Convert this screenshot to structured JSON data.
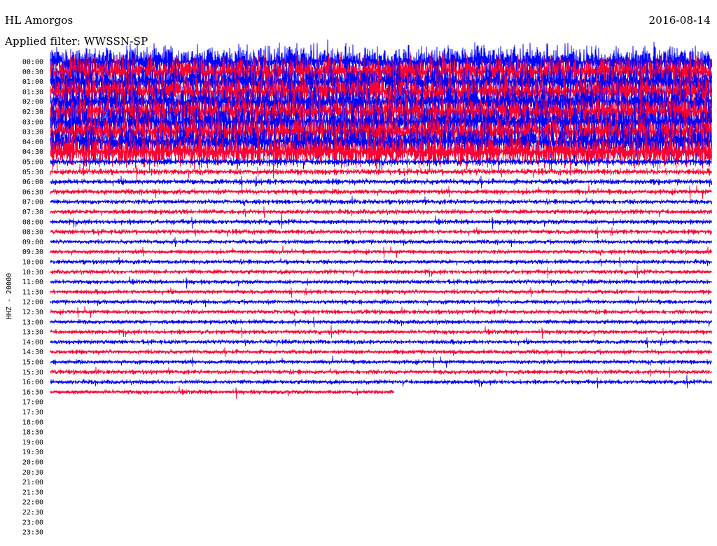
{
  "header": {
    "station": "HL Amorgos",
    "date": "2016-08-14",
    "filter": "Applied filter: WWSSN-SP"
  },
  "chart_data": {
    "type": "line",
    "ylabel": "HHZ - 20000",
    "row_times": [
      "00:00",
      "00:30",
      "01:00",
      "01:30",
      "02:00",
      "02:30",
      "03:00",
      "03:30",
      "04:00",
      "04:30",
      "05:00",
      "05:30",
      "06:00",
      "06:30",
      "07:00",
      "07:30",
      "08:00",
      "08:30",
      "09:00",
      "09:30",
      "10:00",
      "10:30",
      "11:00",
      "11:30",
      "12:00",
      "12:30",
      "13:00",
      "13:30",
      "14:00",
      "14:30",
      "15:00",
      "15:30",
      "16:00",
      "16:30",
      "17:00",
      "17:30",
      "18:00",
      "18:30",
      "19:00",
      "19:30",
      "20:00",
      "20:30",
      "21:00",
      "21:30",
      "22:00",
      "22:30",
      "23:00",
      "23:30"
    ],
    "colors": [
      "#0000ff",
      "#ff0033"
    ],
    "last_row_index": 33,
    "last_row_fraction": 0.52,
    "amplitude_class": [
      3,
      3,
      3,
      3,
      3,
      3,
      3,
      3,
      3,
      3,
      1.6,
      1.4,
      1.3,
      1.2,
      1.1,
      1.1,
      1.1,
      1.1,
      1,
      1,
      1,
      1,
      1,
      1,
      1,
      1,
      1,
      1,
      1,
      1,
      1,
      1,
      1,
      1
    ]
  }
}
